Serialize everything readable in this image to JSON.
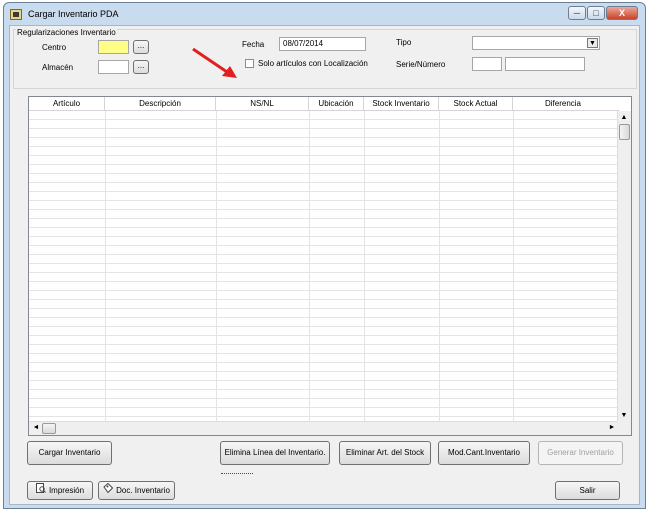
{
  "window": {
    "title": "Cargar Inventario PDA",
    "controls": {
      "minimize": "─",
      "maximize": "□",
      "close": "X"
    }
  },
  "filters": {
    "group_title": "Regularizaciones Inventario",
    "centro_label": "Centro",
    "centro_value": "",
    "almacen_label": "Almacén",
    "almacen_value": "",
    "lookup_button": "...",
    "fecha_label": "Fecha",
    "fecha_value": "08/07/2014",
    "solo_localizacion_label": "Solo artículos con Localización",
    "solo_localizacion_checked": false,
    "tipo_label": "Tipo",
    "tipo_value": "",
    "serie_label": "Serie/Número",
    "serie_value": "",
    "numero_value": ""
  },
  "grid": {
    "columns": [
      "Artículo",
      "Descripción",
      "NS/NL",
      "Ubicación",
      "Stock Inventario",
      "Stock Actual",
      "Diferencia"
    ],
    "rows": [],
    "scroll_up": "▲",
    "scroll_down": "▼",
    "scroll_left": "◄",
    "scroll_right": "►"
  },
  "buttons": {
    "cargar_inventario": "Cargar Inventario",
    "elimina_linea": "Elimina Línea del Inventario.",
    "eliminar_art_stock": "Eliminar Art. del Stock",
    "mod_cant_inventario": "Mod.Cant.Inventario",
    "generar_inventario": "Generar Inventario",
    "impresion": "Impresión",
    "doc_inventario": "Doc. Inventario",
    "salir": "Salir"
  },
  "icons": {
    "window": "app-window-icon",
    "impresion": "print-preview-icon",
    "doc_inventario": "document-tag-icon",
    "annotation": "red-arrow-icon"
  },
  "colors": {
    "titlebar": "#c9dbef",
    "highlight_field": "#ffff88",
    "annotation_arrow": "#e02020",
    "close_button": "#c8442b"
  }
}
